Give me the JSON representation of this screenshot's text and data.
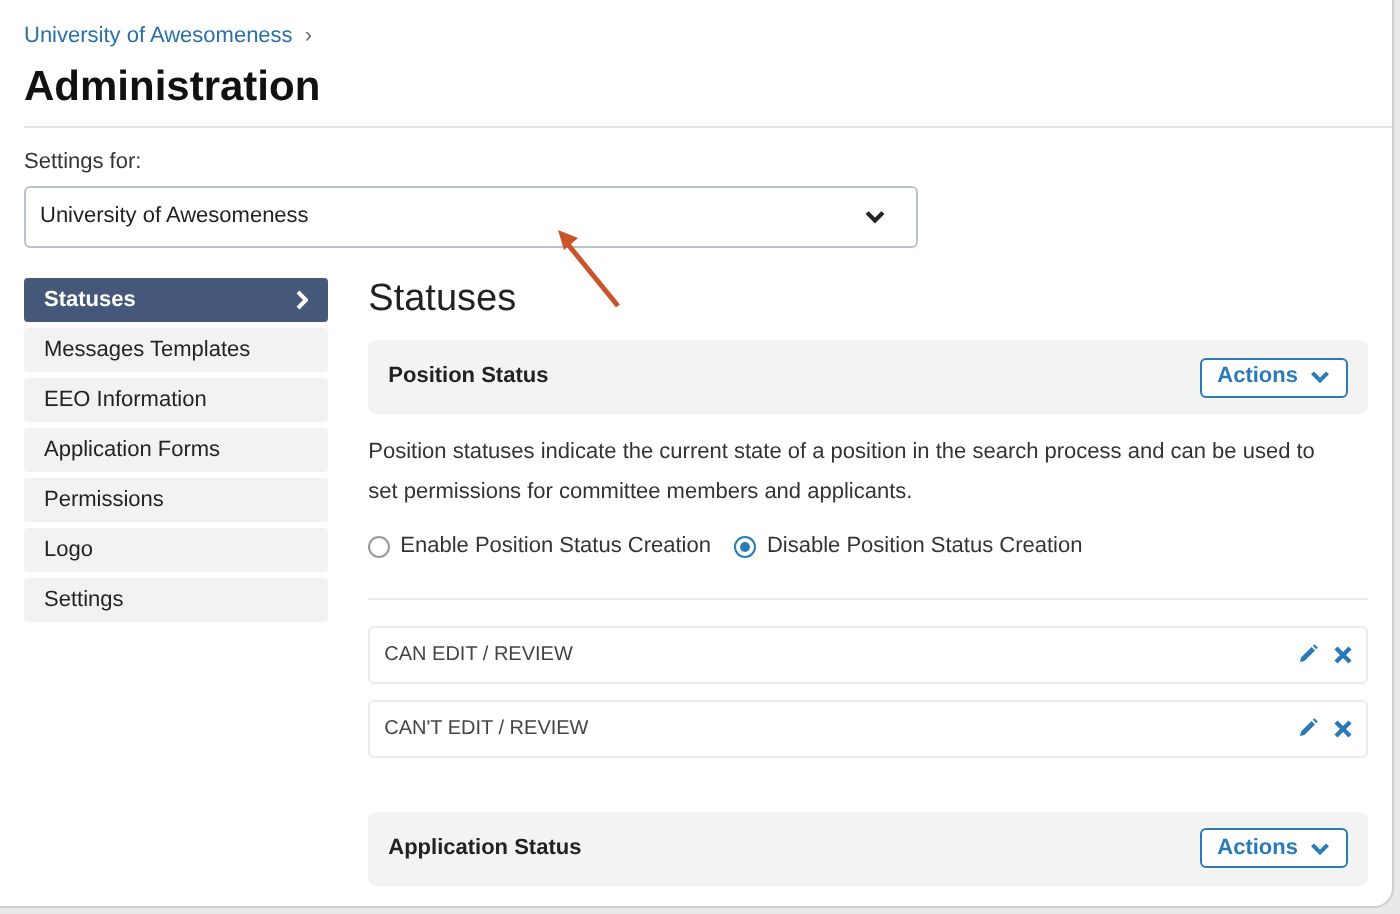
{
  "breadcrumb": {
    "link": "University of Awesomeness",
    "separator": "›"
  },
  "title": "Administration",
  "settings_for": {
    "label": "Settings for:",
    "value": "University of Awesomeness"
  },
  "sidebar": {
    "items": [
      {
        "label": "Statuses",
        "selected": true
      },
      {
        "label": "Messages Templates",
        "selected": false
      },
      {
        "label": "EEO Information",
        "selected": false
      },
      {
        "label": "Application Forms",
        "selected": false
      },
      {
        "label": "Permissions",
        "selected": false
      },
      {
        "label": "Logo",
        "selected": false
      },
      {
        "label": "Settings",
        "selected": false
      }
    ]
  },
  "heading": "Statuses",
  "position_status": {
    "title": "Position Status",
    "actions": "Actions",
    "description": "Position statuses indicate the current state of a position in the search process and can be used to set permissions for committee members and applicants.",
    "options": [
      {
        "label": "Enable Position Status Creation",
        "selected": false
      },
      {
        "label": "Disable Position Status Creation",
        "selected": true
      }
    ],
    "statuses": [
      {
        "name": "CAN EDIT / REVIEW"
      },
      {
        "name": "CAN'T EDIT / REVIEW"
      }
    ]
  },
  "application_status": {
    "title": "Application Status",
    "actions": "Actions"
  }
}
